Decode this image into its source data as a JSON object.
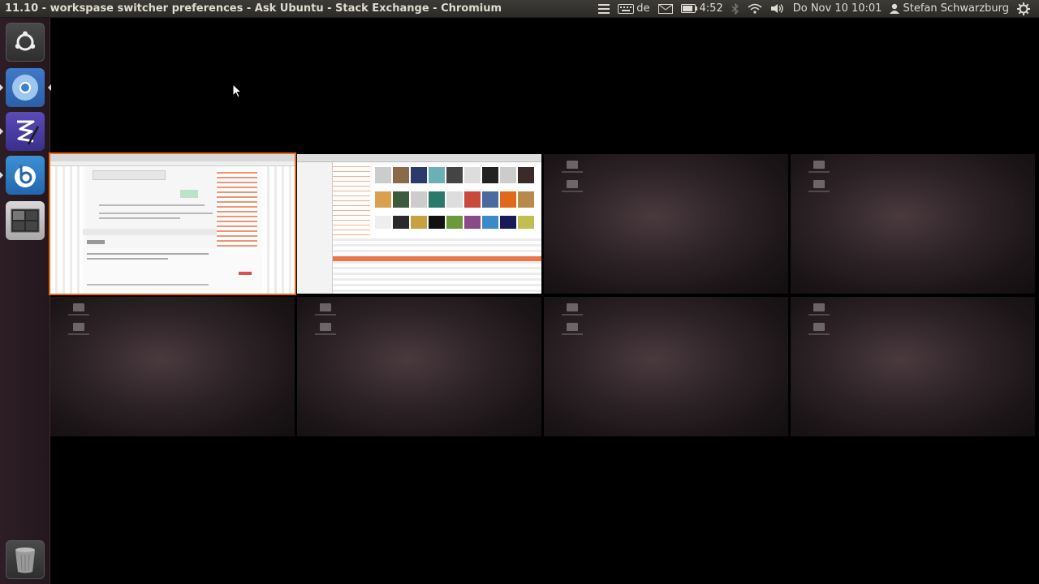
{
  "top_panel": {
    "window_title": "11.10 - workspase switcher preferences - Ask Ubuntu - Stack Exchange - Chromium",
    "keyboard_layout": "de",
    "battery_time": "4:52",
    "datetime": "Do Nov 10 10:01",
    "user_name": "Stefan Schwarzburg"
  },
  "launcher": {
    "items": [
      {
        "name": "dash-home",
        "icon": "ubuntu-logo-icon"
      },
      {
        "name": "chromium",
        "icon": "chromium-icon"
      },
      {
        "name": "emacs",
        "icon": "emacs-icon"
      },
      {
        "name": "banshee",
        "icon": "banshee-icon"
      },
      {
        "name": "workspace-switcher",
        "icon": "workspace-switcher-icon"
      },
      {
        "name": "trash",
        "icon": "trash-icon"
      }
    ]
  },
  "workspaces": {
    "columns": 4,
    "rows": 2,
    "active_index": 0,
    "accent_color": "#e46a1a"
  },
  "colors": {
    "panel_bg": "#3c3b37",
    "launcher_bg": "#2d1e26",
    "panel_text": "#dfdbd2"
  }
}
